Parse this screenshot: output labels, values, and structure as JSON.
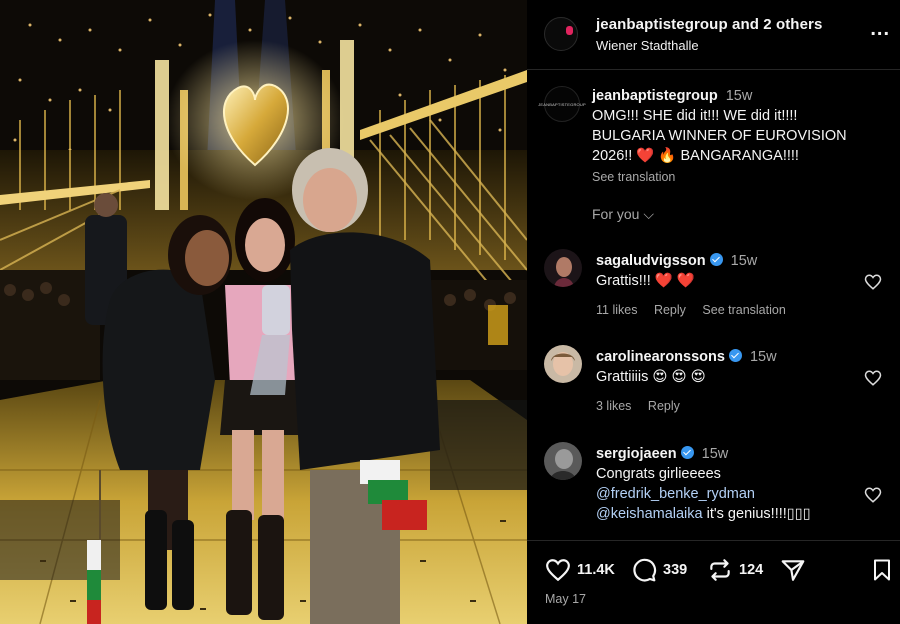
{
  "header": {
    "username": "jeanbaptistegroup",
    "coauthors": "and 2 others",
    "location": "Wiener Stadthalle",
    "more": "..."
  },
  "caption": {
    "avatar_text": "JEANBAPTISTEGROUP",
    "username": "jeanbaptistegroup",
    "time": "15w",
    "text_line1": "OMG!!! SHE did it!!! WE did it!!!!",
    "text_line2": "BULGARIA WINNER OF EUROVISION",
    "text_line3": "2026!! ❤️ 🔥 BANGARANGA!!!!",
    "see_translation": "See translation"
  },
  "for_you": "For you ⌵",
  "comments": [
    {
      "username": "sagaludvigsson",
      "time": "15w",
      "text": "Grattis!!! ❤️ ❤️",
      "likes": "11 likes",
      "reply": "Reply",
      "see_translation": "See translation"
    },
    {
      "username": "carolinearonssons",
      "time": "15w",
      "text": "Grattiiiis 😍 😍 😍",
      "likes": "3 likes",
      "reply": "Reply"
    },
    {
      "username": "sergiojaeen",
      "time": "15w",
      "text_line1": "Congrats girlieeees",
      "mention1": "@fredrik_benke_rydman",
      "mention2": "@keishamalaika",
      "text_line3": " it's genius!!!!▯▯▯"
    }
  ],
  "actions": {
    "likes": "11.4K",
    "comments": "339",
    "reposts": "124"
  },
  "date": "May 17",
  "colors": {
    "background": "#000000",
    "verified": "#3897f0",
    "mention": "#b3d0f5",
    "muted": "#a8a8a8"
  }
}
